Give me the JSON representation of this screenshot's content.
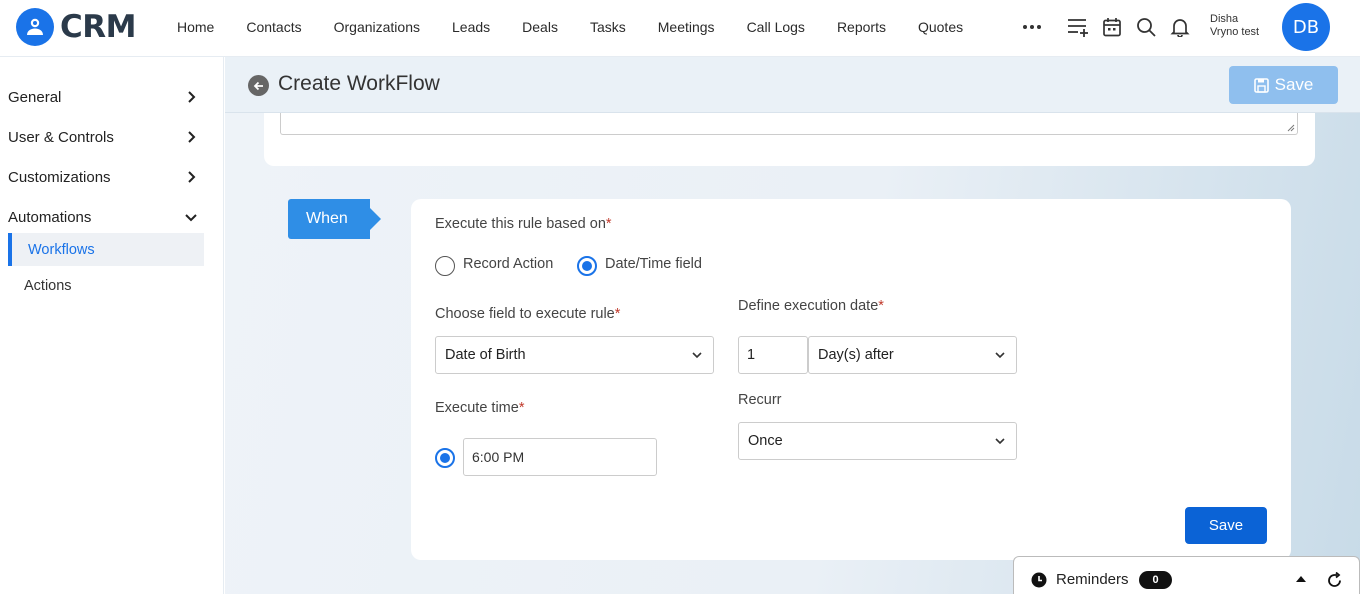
{
  "brand": {
    "name": "CRM",
    "accent": "#1a73e8"
  },
  "nav": {
    "items": [
      "Home",
      "Contacts",
      "Organizations",
      "Leads",
      "Deals",
      "Tasks",
      "Meetings",
      "Call Logs",
      "Reports",
      "Quotes"
    ],
    "more_icon": "ellipsis-icon",
    "icons": [
      "add-list-icon",
      "calendar-icon",
      "search-icon",
      "bell-icon"
    ]
  },
  "user": {
    "name_line1": "Disha",
    "name_line2": "Vryno test",
    "initials": "DB"
  },
  "sidebar": {
    "items": [
      {
        "label": "General",
        "icon": "chevron-right-icon"
      },
      {
        "label": "User & Controls",
        "icon": "chevron-right-icon"
      },
      {
        "label": "Customizations",
        "icon": "chevron-right-icon"
      },
      {
        "label": "Automations",
        "icon": "chevron-down-icon"
      }
    ],
    "subitems": [
      {
        "label": "Workflows",
        "active": true
      },
      {
        "label": "Actions",
        "active": false
      }
    ]
  },
  "header": {
    "title": "Create WorkFlow",
    "save_label": "Save"
  },
  "when": {
    "tag": "When",
    "rule_label": "Execute this rule based on",
    "options": [
      {
        "label": "Record Action",
        "selected": false
      },
      {
        "label": "Date/Time field",
        "selected": true
      }
    ],
    "field_label": "Choose field to execute rule",
    "field_value": "Date of Birth",
    "date_label": "Define execution date",
    "date_offset": "1",
    "date_unit": "Day(s) after",
    "time_label": "Execute time",
    "time_value": "6:00 PM",
    "recur_label": "Recurr",
    "recur_value": "Once",
    "required_mark": "*",
    "save_label": "Save"
  },
  "reminders": {
    "label": "Reminders",
    "count": "0"
  }
}
